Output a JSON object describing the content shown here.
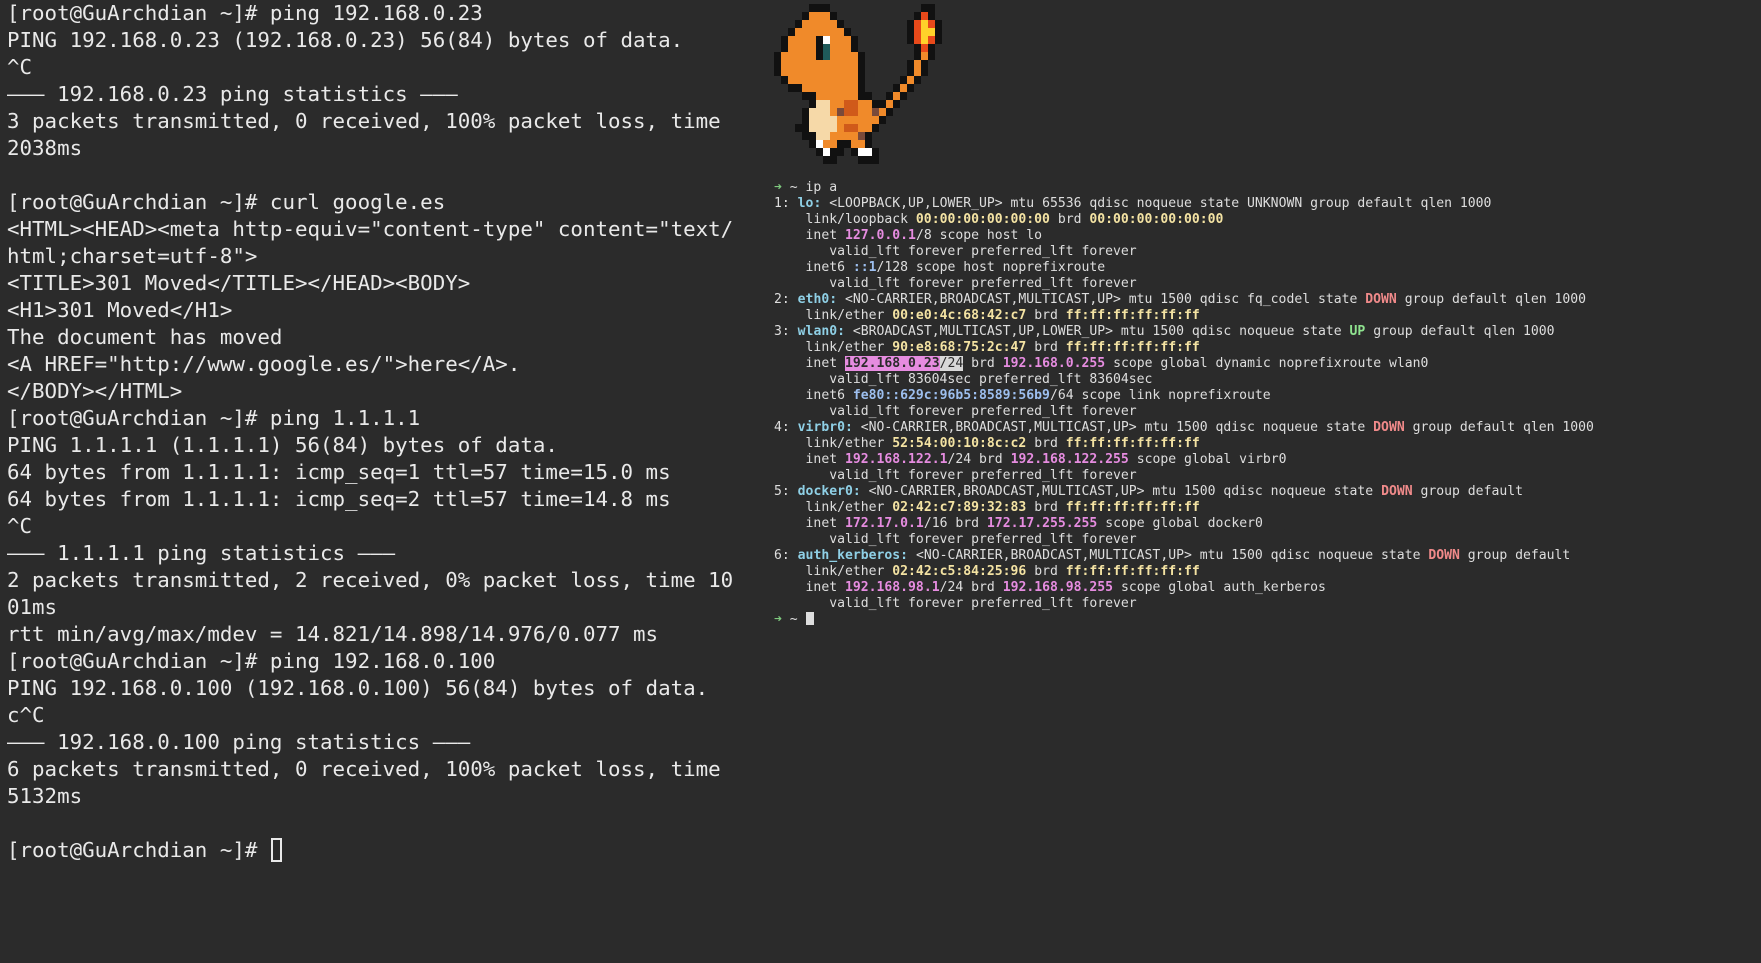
{
  "left_terminal": {
    "lines": [
      "[root@GuArchdian ~]# ping 192.168.0.23",
      "PING 192.168.0.23 (192.168.0.23) 56(84) bytes of data.",
      "^C",
      "––– 192.168.0.23 ping statistics –––",
      "3 packets transmitted, 0 received, 100% packet loss, time",
      "2038ms",
      "",
      "[root@GuArchdian ~]# curl google.es",
      "<HTML><HEAD><meta http-equiv=\"content-type\" content=\"text/",
      "html;charset=utf-8\">",
      "<TITLE>301 Moved</TITLE></HEAD><BODY>",
      "<H1>301 Moved</H1>",
      "The document has moved",
      "<A HREF=\"http://www.google.es/\">here</A>.",
      "</BODY></HTML>",
      "[root@GuArchdian ~]# ping 1.1.1.1",
      "PING 1.1.1.1 (1.1.1.1) 56(84) bytes of data.",
      "64 bytes from 1.1.1.1: icmp_seq=1 ttl=57 time=15.0 ms",
      "64 bytes from 1.1.1.1: icmp_seq=2 ttl=57 time=14.8 ms",
      "^C",
      "––– 1.1.1.1 ping statistics –––",
      "2 packets transmitted, 2 received, 0% packet loss, time 10",
      "01ms",
      "rtt min/avg/max/mdev = 14.821/14.898/14.976/0.077 ms",
      "[root@GuArchdian ~]# ping 192.168.0.100",
      "PING 192.168.0.100 (192.168.0.100) 56(84) bytes of data.",
      "c^C",
      "––– 192.168.0.100 ping statistics –––",
      "6 packets transmitted, 0 received, 100% packet loss, time",
      "5132ms",
      ""
    ],
    "prompt": "[root@GuArchdian ~]# "
  },
  "right_terminal": {
    "prompt_arrow": "➜",
    "command_line": "~ ip a",
    "interfaces": [
      {
        "index": "1:",
        "name": "lo:",
        "flags": "<LOOPBACK,UP,LOWER_UP> mtu 65536 qdisc noqueue state",
        "state": "UNKNOWN",
        "tail": "group default qlen 1000",
        "link_type": "link/loopback",
        "mac": "00:00:00:00:00:00",
        "brd_label": "brd",
        "brd_mac": "00:00:00:00:00:00",
        "inet_label": "inet",
        "inet_addr": "127.0.0.1",
        "inet_prefix": "/8 scope host lo",
        "valid1": "valid_lft forever preferred_lft forever",
        "inet6_label": "inet6",
        "inet6_addr": "::1",
        "inet6_rest": "/128 scope host noprefixroute",
        "valid2": "valid_lft forever preferred_lft forever"
      },
      {
        "index": "2:",
        "name": "eth0:",
        "flags": "<NO-CARRIER,BROADCAST,MULTICAST,UP> mtu 1500 qdisc fq_codel state",
        "state": "DOWN",
        "tail": "group default qlen 1000",
        "link_type": "link/ether",
        "mac": "00:e0:4c:68:42:c7",
        "brd_label": "brd",
        "brd_mac": "ff:ff:ff:ff:ff:ff"
      },
      {
        "index": "3:",
        "name": "wlan0:",
        "flags": "<BROADCAST,MULTICAST,UP,LOWER_UP> mtu 1500 qdisc noqueue state",
        "state": "UP",
        "tail": "group default qlen 1000",
        "link_type": "link/ether",
        "mac": "90:e8:68:75:2c:47",
        "brd_label": "brd",
        "brd_mac": "ff:ff:ff:ff:ff:ff",
        "inet_label": "inet",
        "inet_addr": "192.168.0.23",
        "inet_prefix": "/24",
        "inet_brd_label": "brd",
        "inet_brd": "192.168.0.255",
        "inet_rest": "scope global dynamic noprefixroute wlan0",
        "valid1": "valid_lft 83604sec preferred_lft 83604sec",
        "inet6_label": "inet6",
        "inet6_addr": "fe80::629c:96b5:8589:56b9",
        "inet6_rest": "/64 scope link noprefixroute",
        "valid2": "valid_lft forever preferred_lft forever"
      },
      {
        "index": "4:",
        "name": "virbr0:",
        "flags": "<NO-CARRIER,BROADCAST,MULTICAST,UP> mtu 1500 qdisc noqueue state",
        "state": "DOWN",
        "tail": "group default qlen 1000",
        "link_type": "link/ether",
        "mac": "52:54:00:10:8c:c2",
        "brd_label": "brd",
        "brd_mac": "ff:ff:ff:ff:ff:ff",
        "inet_label": "inet",
        "inet_addr": "192.168.122.1",
        "inet_prefix": "/24",
        "inet_brd_label": "brd",
        "inet_brd": "192.168.122.255",
        "inet_rest": "scope global virbr0",
        "valid1": "valid_lft forever preferred_lft forever"
      },
      {
        "index": "5:",
        "name": "docker0:",
        "flags": "<NO-CARRIER,BROADCAST,MULTICAST,UP> mtu 1500 qdisc noqueue state",
        "state": "DOWN",
        "tail": "group default",
        "link_type": "link/ether",
        "mac": "02:42:c7:89:32:83",
        "brd_label": "brd",
        "brd_mac": "ff:ff:ff:ff:ff:ff",
        "inet_label": "inet",
        "inet_addr": "172.17.0.1",
        "inet_prefix": "/16",
        "inet_brd_label": "brd",
        "inet_brd": "172.17.255.255",
        "inet_rest": "scope global docker0",
        "valid1": "valid_lft forever preferred_lft forever"
      },
      {
        "index": "6:",
        "name": "auth_kerberos:",
        "flags": "<NO-CARRIER,BROADCAST,MULTICAST,UP> mtu 1500 qdisc noqueue state",
        "state": "DOWN",
        "tail": "group default",
        "link_type": "link/ether",
        "mac": "02:42:c5:84:25:96",
        "brd_label": "brd",
        "brd_mac": "ff:ff:ff:ff:ff:ff",
        "inet_label": "inet",
        "inet_addr": "192.168.98.1",
        "inet_prefix": "/24",
        "inet_brd_label": "brd",
        "inet_brd": "192.168.98.255",
        "inet_rest": "scope global auth_kerberos",
        "valid1": "valid_lft forever preferred_lft forever"
      }
    ],
    "final_prompt": "~"
  },
  "colors": {
    "background": "#2b2b2b",
    "text": "#e9e9e9",
    "prompt_arrow": "#7ec97e",
    "iface_name": "#8fd0e6",
    "mac": "#f4e3a3",
    "ip": "#e68ce0",
    "state_down": "#f08a8a",
    "state_up": "#8fe38f"
  },
  "icons": {
    "sprite": "charmander-pixel-art",
    "left_cursor": "block-cursor-outline",
    "right_cursor": "block-cursor-solid"
  }
}
